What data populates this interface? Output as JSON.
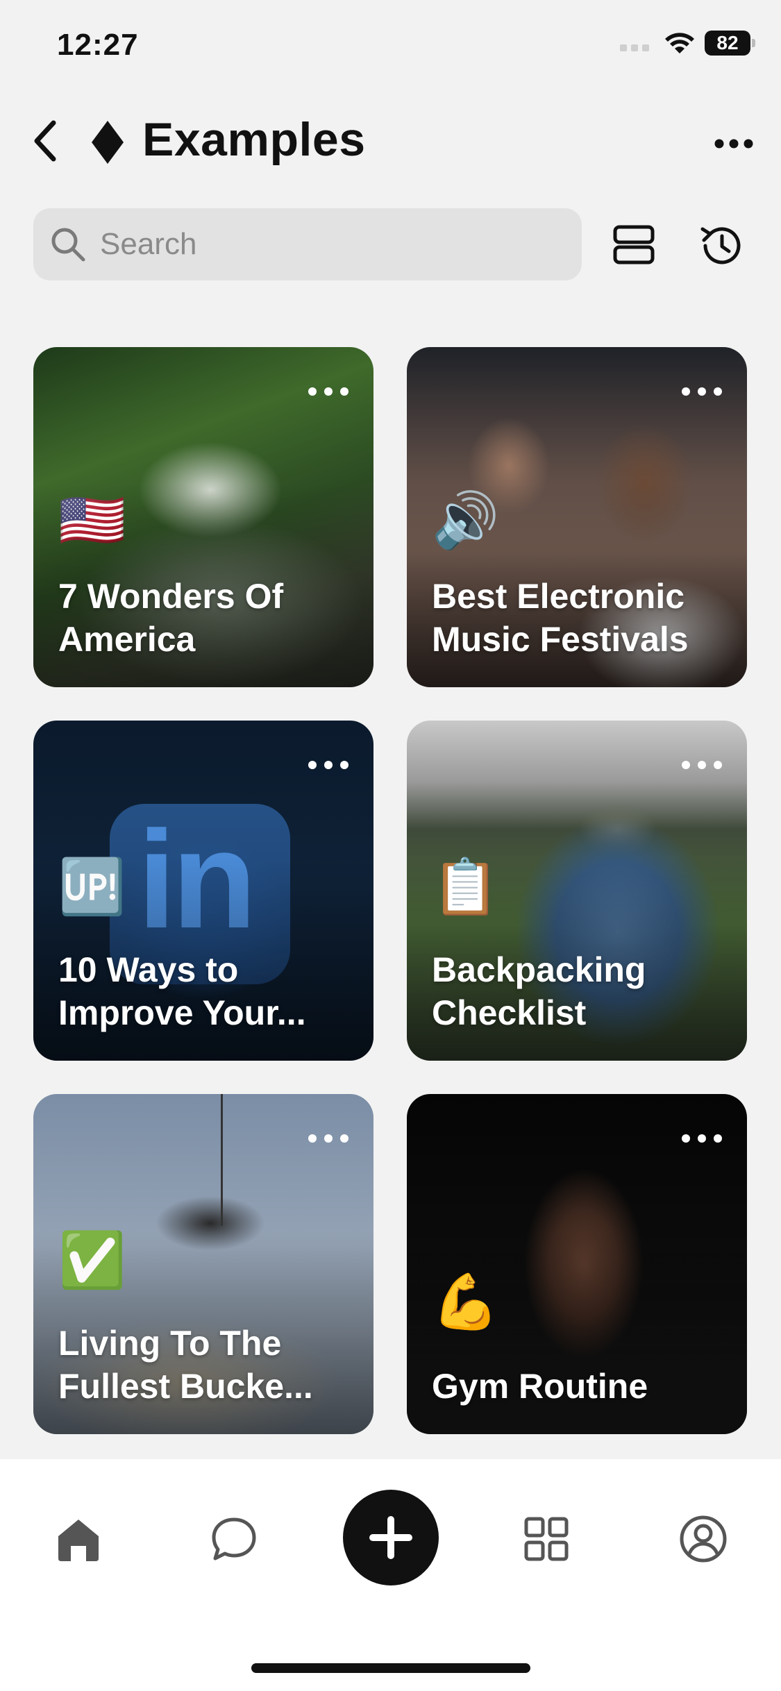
{
  "status_bar": {
    "time": "12:27",
    "battery": "82"
  },
  "header": {
    "title": "Examples"
  },
  "search": {
    "placeholder": "Search"
  },
  "cards": [
    {
      "title": "7 Wonders Of America",
      "emoji": "🇺🇸"
    },
    {
      "title": "Best Electronic Music Festivals",
      "emoji": "🔊"
    },
    {
      "title": "10 Ways to Improve Your...",
      "emoji": "🆙"
    },
    {
      "title": "Backpacking Checklist",
      "emoji": "📋"
    },
    {
      "title": "Living To The Fullest Bucke...",
      "emoji": "✅"
    },
    {
      "title": "Gym Routine",
      "emoji": "💪"
    }
  ],
  "tabbar": {
    "items": [
      "home-icon",
      "chat-icon",
      "add-icon",
      "grid-icon",
      "profile-icon"
    ]
  }
}
